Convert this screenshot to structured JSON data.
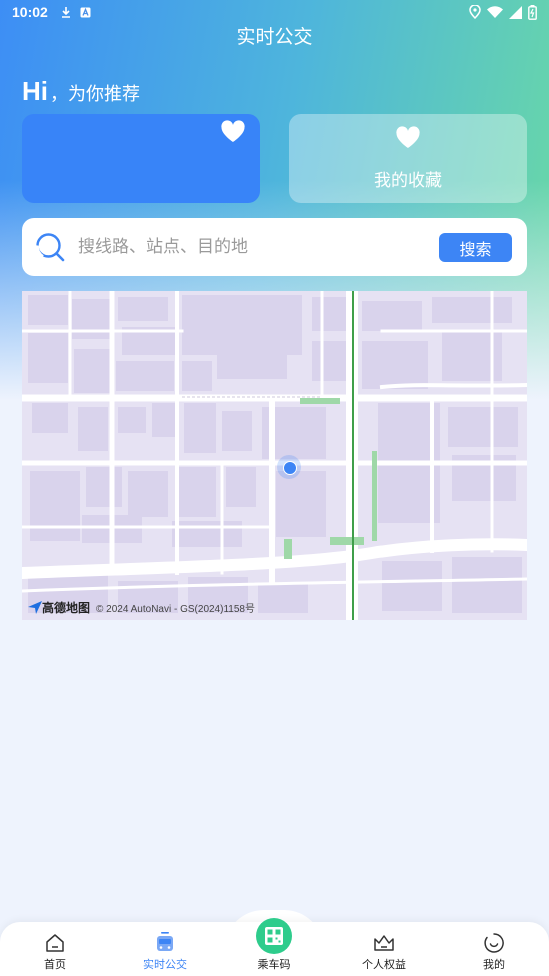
{
  "status_bar": {
    "time": "10:02",
    "left_icons": [
      "download-icon",
      "a-badge-icon"
    ],
    "right_icons": [
      "location-icon",
      "wifi-icon",
      "signal-icon",
      "battery-icon"
    ]
  },
  "header": {
    "title": "实时公交"
  },
  "greeting": {
    "hi": "Hi",
    "sub": "，为你推荐"
  },
  "cards": {
    "recommend": {
      "icon": "heart-icon",
      "color": "#3884f8"
    },
    "favorites": {
      "icon": "heart-icon",
      "label": "我的收藏"
    }
  },
  "search": {
    "placeholder": "搜线路、站点、目的地",
    "button_label": "搜索"
  },
  "map": {
    "logo_text": "高德地图",
    "attribution": "© 2024 AutoNavi - GS(2024)1158号"
  },
  "bottom_nav": {
    "items": [
      {
        "label": "首页",
        "icon": "home-icon"
      },
      {
        "label": "实时公交",
        "icon": "bus-icon",
        "active": true
      },
      {
        "label": "乘车码",
        "icon": "qr-code-icon"
      },
      {
        "label": "个人权益",
        "icon": "crown-icon"
      },
      {
        "label": "我的",
        "icon": "smile-icon"
      }
    ]
  },
  "colors": {
    "accent": "#3d85f5",
    "scan_green": "#2ecc8c"
  }
}
